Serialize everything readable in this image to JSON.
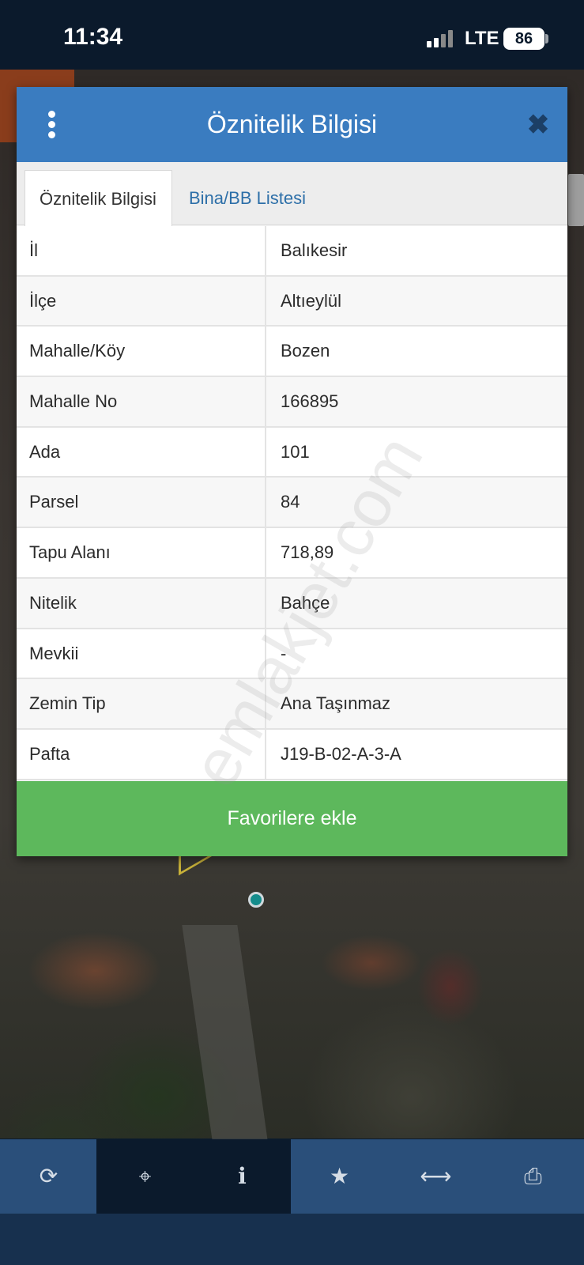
{
  "status_bar": {
    "time": "11:34",
    "network": "LTE",
    "battery": "86"
  },
  "modal": {
    "title": "Öznitelik Bilgisi",
    "menu_icon": "kebab-menu-icon",
    "close_icon": "close-icon",
    "tabs": [
      {
        "label": "Öznitelik Bilgisi",
        "active": true
      },
      {
        "label": "Bina/BB Listesi",
        "active": false
      }
    ],
    "rows": [
      {
        "key": "İl",
        "value": "Balıkesir"
      },
      {
        "key": "İlçe",
        "value": "Altıeylül"
      },
      {
        "key": "Mahalle/Köy",
        "value": "Bozen"
      },
      {
        "key": "Mahalle No",
        "value": "166895"
      },
      {
        "key": "Ada",
        "value": "101"
      },
      {
        "key": "Parsel",
        "value": "84"
      },
      {
        "key": "Tapu Alanı",
        "value": "718,89"
      },
      {
        "key": "Nitelik",
        "value": "Bahçe"
      },
      {
        "key": "Mevkii",
        "value": "-"
      },
      {
        "key": "Zemin Tip",
        "value": "Ana Taşınmaz"
      },
      {
        "key": "Pafta",
        "value": "J19-B-02-A-3-A"
      }
    ],
    "favorite_button": "Favorilere ekle"
  },
  "watermark": "emlakjet.com",
  "toolbar": {
    "items": [
      {
        "icon": "refresh-icon",
        "glyph": "⟳",
        "active": false
      },
      {
        "icon": "crosshair-icon",
        "glyph": "⌖",
        "active": true
      },
      {
        "icon": "info-icon",
        "glyph": "i",
        "active": true
      },
      {
        "icon": "star-icon",
        "glyph": "★",
        "active": false
      },
      {
        "icon": "measure-icon",
        "glyph": "⟷",
        "active": false
      },
      {
        "icon": "print-icon",
        "glyph": "⎙",
        "active": false
      }
    ]
  },
  "colors": {
    "header": "#3a7cc0",
    "favorite": "#5db85c",
    "toolbar": "#2a4f7a",
    "tab_link": "#2d6fa8"
  }
}
